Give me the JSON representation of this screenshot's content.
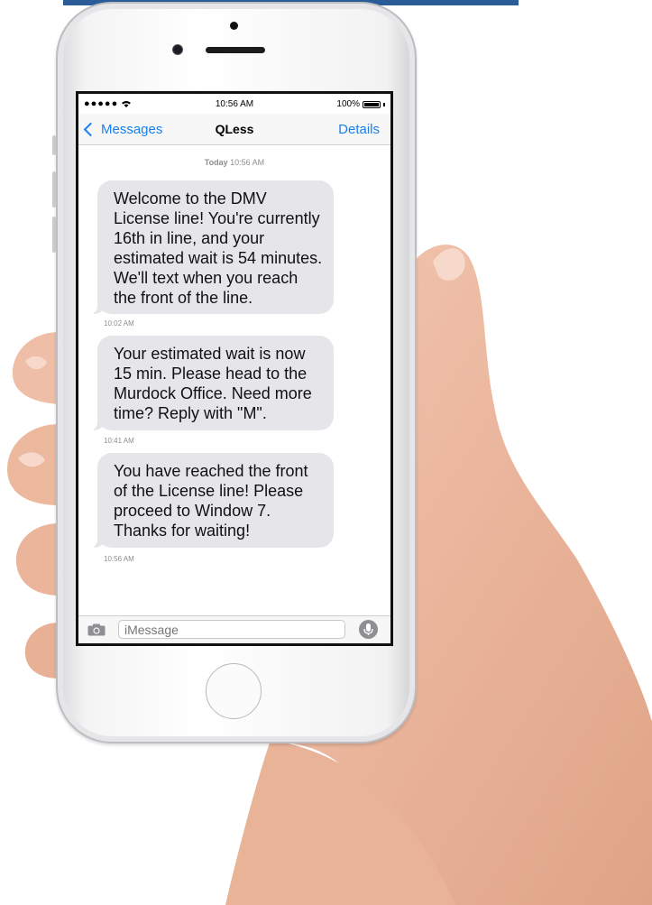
{
  "status_bar": {
    "signal": "●●●●● ",
    "time": "10:56 AM",
    "battery": "100%"
  },
  "nav": {
    "back_label": "Messages",
    "title": "QLess",
    "details_label": "Details"
  },
  "thread": {
    "date_day": "Today",
    "date_time": "10:56 AM"
  },
  "messages": [
    {
      "text": "Welcome to the DMV License line! You're currently 16th in line, and your estimated wait is 54 minutes. We'll text when you reach the front of the line.",
      "time": "10:02 AM"
    },
    {
      "text": "Your estimated wait is now 15 min. Please head to the Murdock Office. Need more time? Reply with \"M\".",
      "time": "10:41 AM"
    },
    {
      "text": "You have reached the front of the License line! Please proceed to Window 7. Thanks for waiting!",
      "time": "10:56 AM"
    }
  ],
  "input": {
    "placeholder": "iMessage"
  },
  "icons": {
    "back": "chevron-left-icon",
    "camera": "camera-icon",
    "mic": "microphone-icon",
    "wifi": "wifi-icon",
    "battery": "battery-icon"
  },
  "colors": {
    "accent": "#1a7ff0",
    "bubble": "#e5e5ea"
  }
}
